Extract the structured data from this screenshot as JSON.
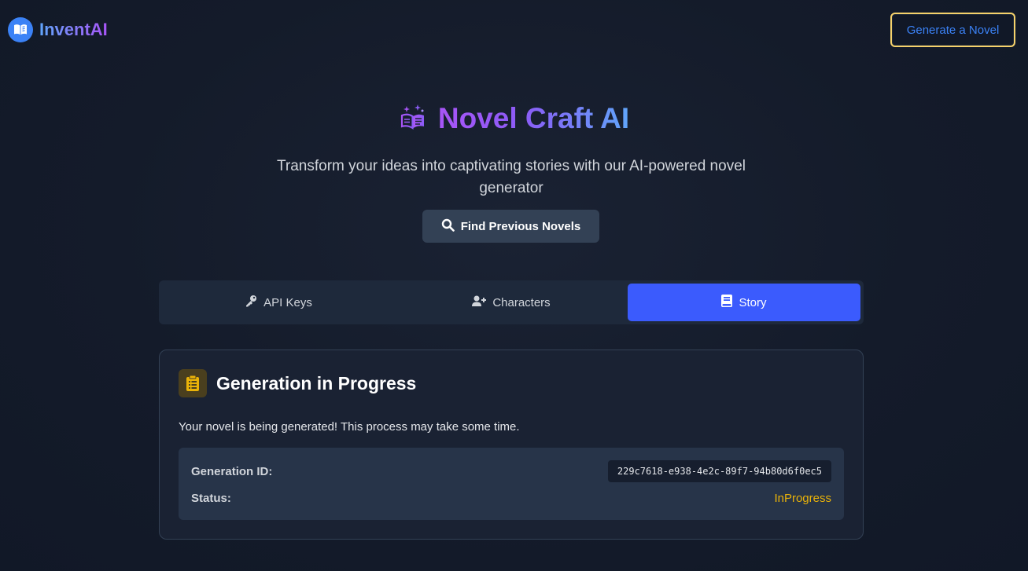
{
  "header": {
    "brand_name": "InventAI",
    "generate_button": "Generate a Novel"
  },
  "hero": {
    "title": "Novel Craft AI",
    "subtitle": "Transform your ideas into captivating stories with our AI-powered novel generator",
    "find_button": "Find Previous Novels"
  },
  "tabs": [
    {
      "label": "API Keys",
      "icon": "key-icon",
      "active": false
    },
    {
      "label": "Characters",
      "icon": "user-plus-icon",
      "active": false
    },
    {
      "label": "Story",
      "icon": "book-icon",
      "active": true
    }
  ],
  "card": {
    "title": "Generation in Progress",
    "description": "Your novel is being generated! This process may take some time.",
    "id_label": "Generation ID:",
    "id_value": "229c7618-e938-4e2c-89f7-94b80d6f0ec5",
    "status_label": "Status:",
    "status_value": "InProgress"
  },
  "colors": {
    "accent_blue": "#3b5bfd",
    "brand_gradient_start": "#60a5fa",
    "brand_gradient_end": "#a855f7",
    "status_yellow": "#eab308",
    "button_border": "#f6d26b"
  }
}
